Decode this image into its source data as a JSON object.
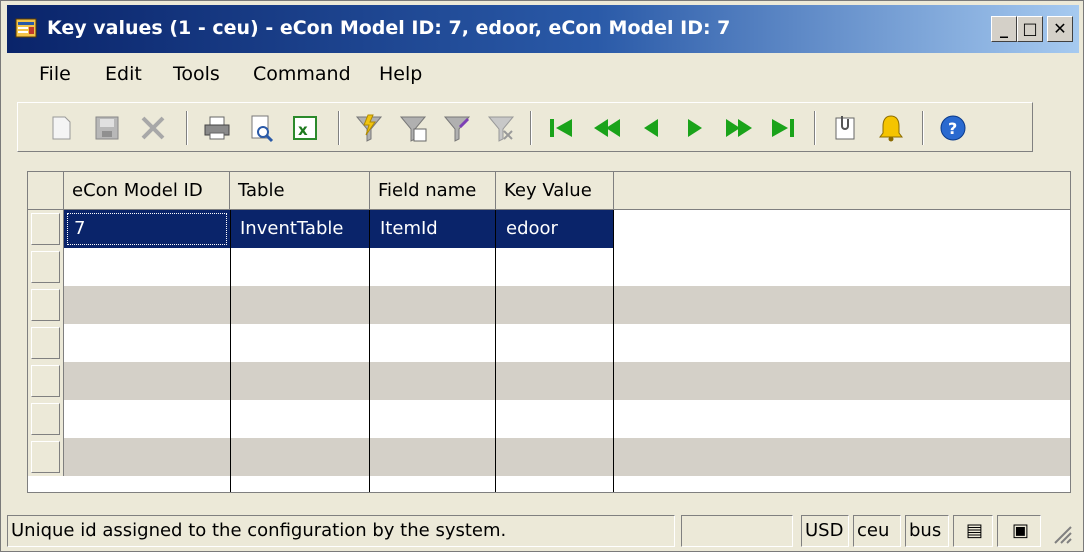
{
  "window": {
    "title": "Key values (1 - ceu) - eCon Model ID: 7, edoor, eCon Model ID: 7",
    "controls": [
      "minimize",
      "maximize",
      "close"
    ]
  },
  "menu": {
    "file": "File",
    "edit": "Edit",
    "tools": "Tools",
    "command": "Command",
    "help": "Help"
  },
  "toolbar": {
    "buttons": [
      "new-icon",
      "save-icon",
      "delete-icon",
      "print-icon",
      "print-preview-icon",
      "export-excel-icon",
      "filter-by-selection-icon",
      "filter-by-grid-icon",
      "advanced-filter-icon",
      "remove-filter-icon",
      "first-record-icon",
      "previous-page-icon",
      "previous-record-icon",
      "next-record-icon",
      "next-page-icon",
      "last-record-icon",
      "document-handling-icon",
      "alert-icon",
      "help-icon"
    ]
  },
  "grid": {
    "columns": [
      "eCon Model ID",
      "Table",
      "Field name",
      "Key Value"
    ],
    "rows": [
      [
        "7",
        "InventTable",
        "ItemId",
        "edoor"
      ]
    ],
    "selected_row_color": "#0a246a",
    "alt_row_color": "#d4d0c8"
  },
  "status": {
    "help_text": "Unique id assigned to the configuration by the system.",
    "blank": "",
    "currency": "USD",
    "company": "ceu",
    "layer": "bus"
  },
  "colors": {
    "title_active": "#0a246a",
    "face": "#ece9d8",
    "nav_green": "#1aa31a"
  }
}
